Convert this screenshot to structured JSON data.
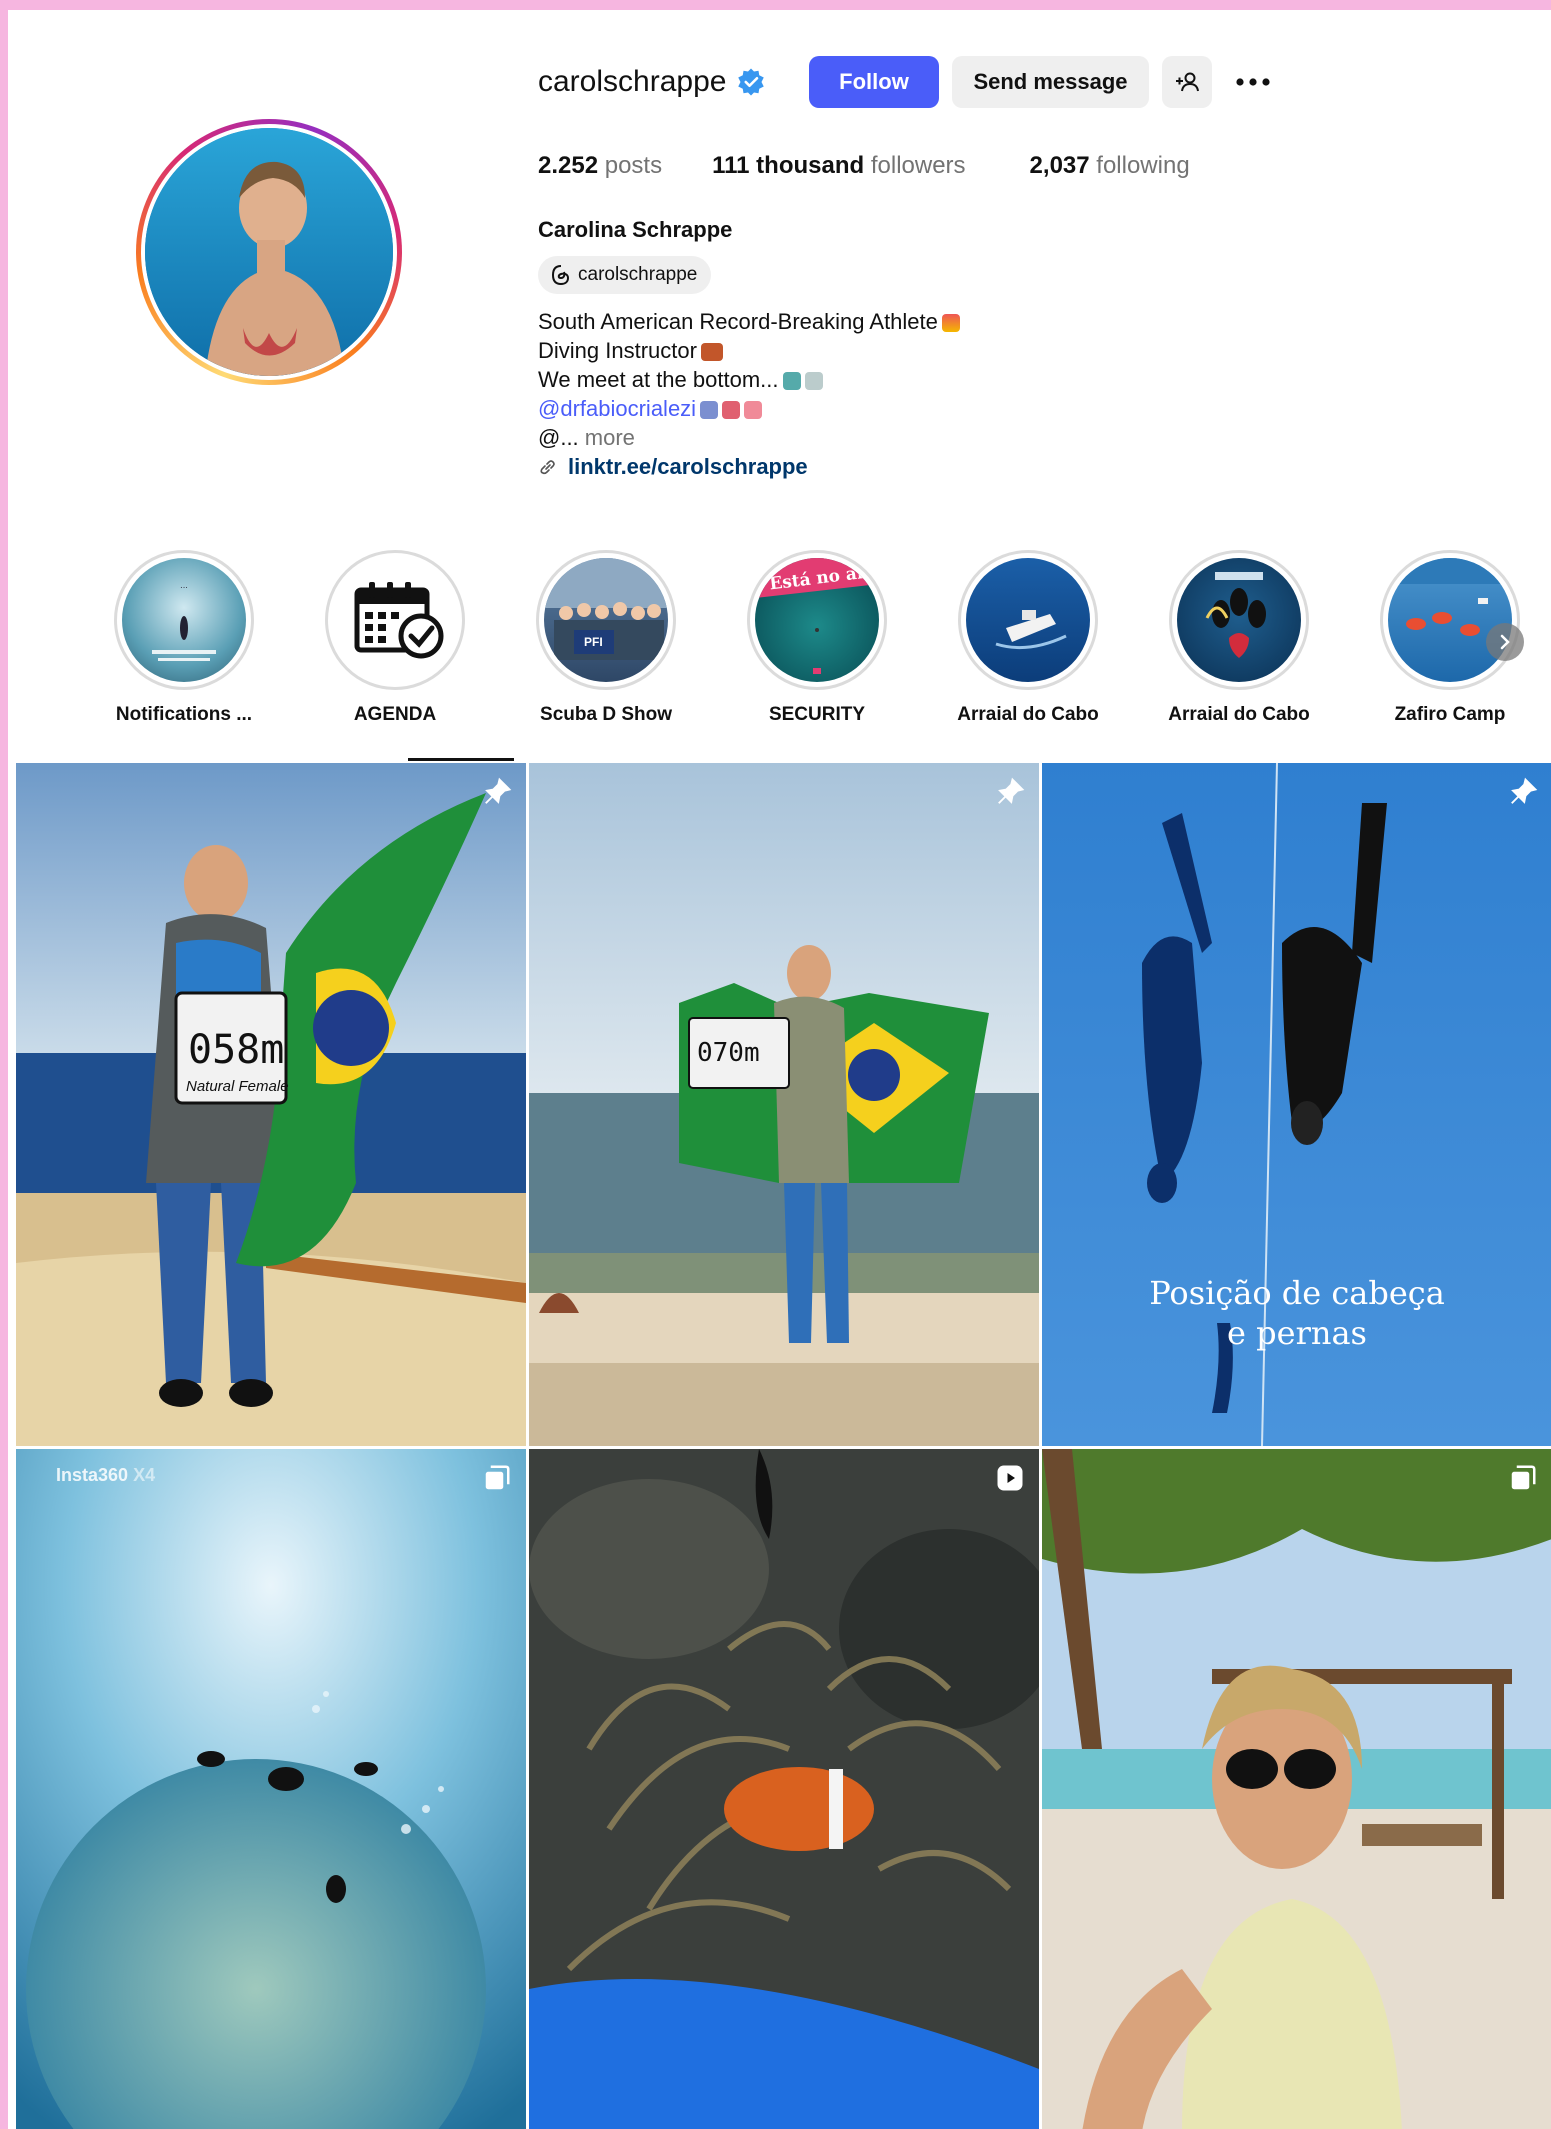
{
  "profile": {
    "username": "carolschrappe",
    "verified": true,
    "follow_label": "Follow",
    "message_label": "Send message",
    "add_icon": "add-person-icon",
    "more_icon": "more-icon",
    "stats": {
      "posts_value": "2.252",
      "posts_label": "posts",
      "followers_value": "111 thousand",
      "followers_label": "followers",
      "following_value": "2,037",
      "following_label": "following"
    },
    "full_name": "Carolina Schrappe",
    "threads_handle": "carolschrappe",
    "bio": {
      "line1": "South American Record-Breaking Athlete",
      "line2": "Diving Instructor",
      "line3": "We meet at the bottom...",
      "mention": "@drfabiocrialezi",
      "line5_prefix": "@...",
      "more": "more",
      "link": "linktr.ee/carolschrappe"
    }
  },
  "highlights": [
    {
      "label": "Notifications ..."
    },
    {
      "label": "AGENDA"
    },
    {
      "label": "Scuba D Show"
    },
    {
      "label": "SECURITY",
      "img_text": "Está no ar"
    },
    {
      "label": "Arraial do Cabo"
    },
    {
      "label": "Arraial do Cabo"
    },
    {
      "label": "Zafiro Camp"
    }
  ],
  "posts": [
    {
      "type": "pinned",
      "icon": "pin-icon",
      "sign": "058m",
      "sign_caption": "Natural Female"
    },
    {
      "type": "pinned",
      "icon": "pin-icon",
      "sign": "070m"
    },
    {
      "type": "pinned",
      "icon": "pin-icon",
      "overlay_line1": "Posição de cabeça",
      "overlay_line2": "e pernas"
    },
    {
      "type": "carousel",
      "icon": "carousel-icon",
      "watermark": "Insta360",
      "watermark_dim": "X4"
    },
    {
      "type": "reel",
      "icon": "reel-icon"
    },
    {
      "type": "carousel",
      "icon": "carousel-icon"
    }
  ],
  "colors": {
    "follow": "#4a5df9",
    "mention": "#4a5df9",
    "link": "#00376b",
    "frame": "#f6b6e0"
  }
}
